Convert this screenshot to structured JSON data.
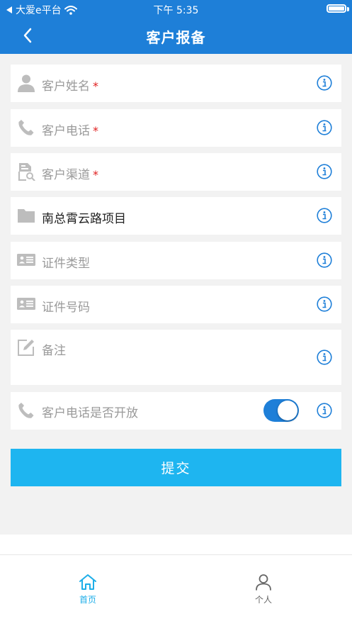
{
  "status_bar": {
    "carrier": "大爱e平台",
    "time": "下午 5:35"
  },
  "nav": {
    "title": "客户报备"
  },
  "form": {
    "fields": [
      {
        "label": "客户姓名",
        "required": "*"
      },
      {
        "label": "客户电话",
        "required": "*"
      },
      {
        "label": "客户渠道",
        "required": "*"
      },
      {
        "value": "南总霄云路项目"
      },
      {
        "label": "证件类型"
      },
      {
        "label": "证件号码"
      },
      {
        "label": "备注"
      },
      {
        "label": "客户电话是否开放"
      }
    ],
    "submit_label": "提交"
  },
  "tabbar": {
    "items": [
      {
        "label": "首页"
      },
      {
        "label": "个人"
      }
    ]
  },
  "colors": {
    "header": "#1e7fd8",
    "submit": "#1eb5f0",
    "tab_active": "#1eaee8",
    "tab_inactive": "#666666"
  }
}
